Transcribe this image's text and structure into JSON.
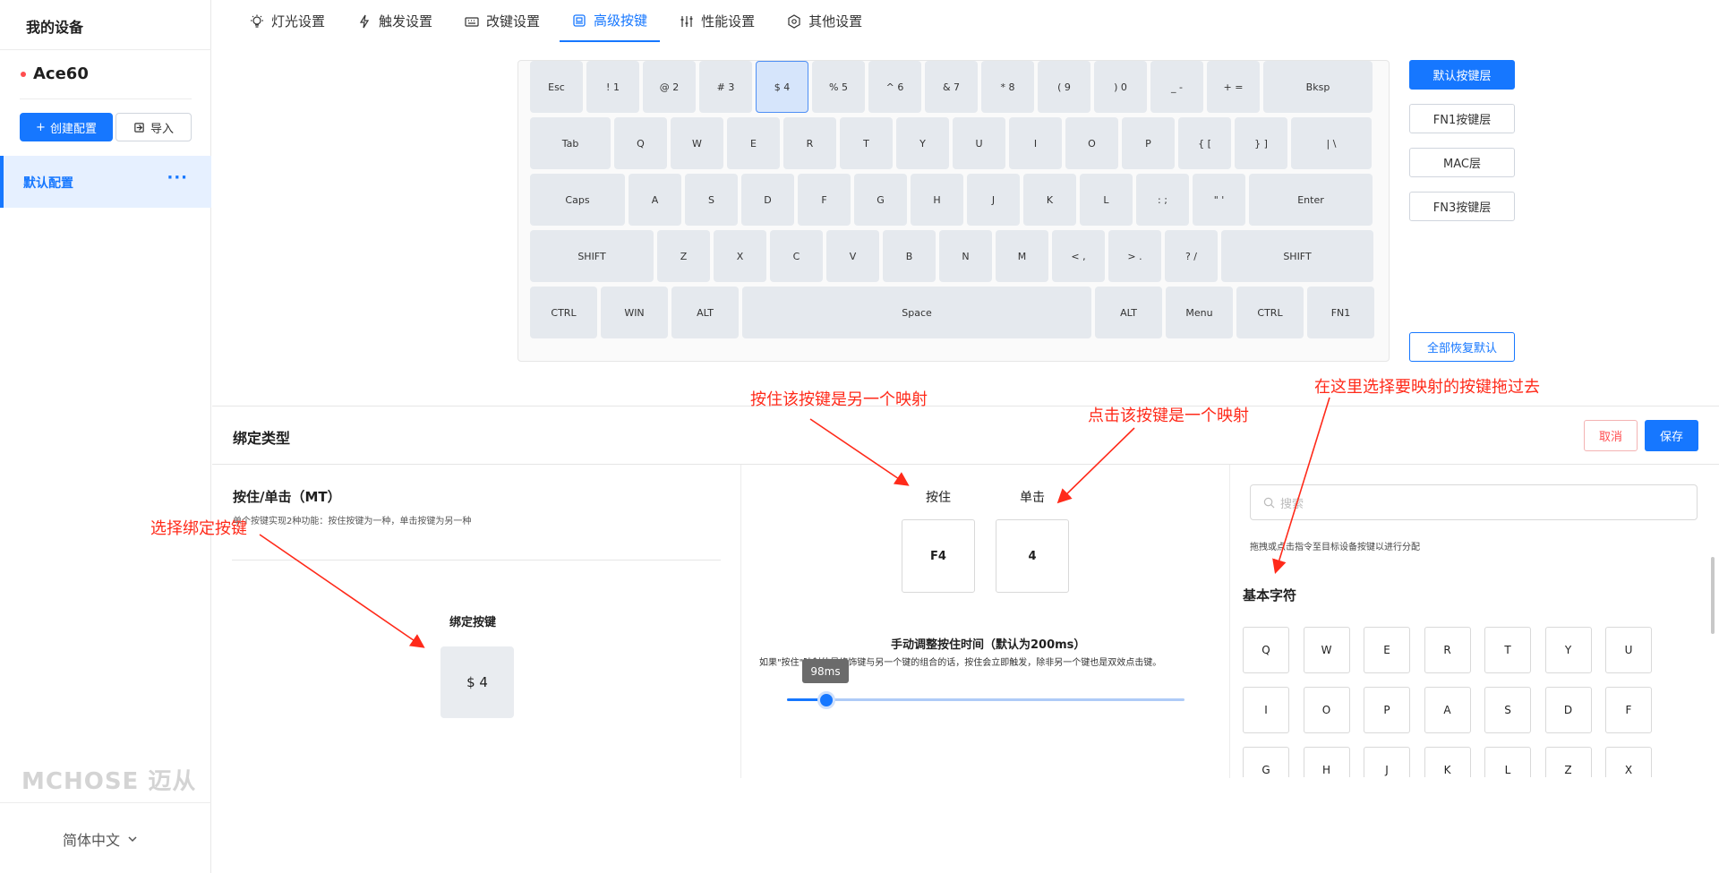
{
  "sidebar": {
    "title": "我的设备",
    "device_name": "Ace60",
    "create_label": "创建配置",
    "import_label": "导入",
    "config_name": "默认配置",
    "more_label": "···",
    "brand": "MCHOSE 迈从",
    "language": "简体中文"
  },
  "tabs": [
    {
      "label": "灯光设置",
      "icon": "bulb-icon"
    },
    {
      "label": "触发设置",
      "icon": "lightning-icon"
    },
    {
      "label": "改键设置",
      "icon": "keyboard-icon"
    },
    {
      "label": "高级按键",
      "icon": "advanced-key-icon",
      "active": true
    },
    {
      "label": "性能设置",
      "icon": "sliders-icon"
    },
    {
      "label": "其他设置",
      "icon": "gear-icon"
    }
  ],
  "keyboard": {
    "selected_key": "$ 4",
    "rows": [
      [
        "Esc",
        "! 1",
        "@ 2",
        "# 3",
        "$ 4",
        "% 5",
        "^ 6",
        "& 7",
        "* 8",
        "( 9",
        ") 0",
        "_ -",
        "+ =",
        "Bksp"
      ],
      [
        "Tab",
        "Q",
        "W",
        "E",
        "R",
        "T",
        "Y",
        "U",
        "I",
        "O",
        "P",
        "{ [",
        "} ]",
        "| \\"
      ],
      [
        "Caps",
        "A",
        "S",
        "D",
        "F",
        "G",
        "H",
        "J",
        "K",
        "L",
        ": ;",
        "\" '",
        "Enter"
      ],
      [
        "SHIFT",
        "Z",
        "X",
        "C",
        "V",
        "B",
        "N",
        "M",
        "< ,",
        "> .",
        "? /",
        "SHIFT"
      ],
      [
        "CTRL",
        "WIN",
        "ALT",
        "Space",
        "ALT",
        "Menu",
        "CTRL",
        "FN1"
      ]
    ]
  },
  "layers": {
    "items": [
      "默认按键层",
      "FN1按键层",
      "MAC层",
      "FN3按键层"
    ],
    "active": "默认按键层",
    "reset_label": "全部恢复默认"
  },
  "panel": {
    "title": "绑定类型",
    "cancel_label": "取消",
    "save_label": "保存",
    "mt_title": "按住/单击（MT）",
    "mt_desc": "单个按键实现2种功能：按住按键为一种，单击按键为另一种",
    "bind_key_label": "绑定按键",
    "bind_key_value": "$ 4",
    "hold_label": "按住",
    "tap_label": "单击",
    "hold_value": "F4",
    "tap_value": "4",
    "adjust_title": "手动调整按住时间（默认为200ms）",
    "adjust_desc": "如果\"按住\"映射的是修饰键与另一个键的组合的话，按住会立即触发，除非另一个键也是双效点击键。",
    "slider_value_label": "98ms",
    "slider_fraction": 0.098,
    "search_placeholder": "搜索",
    "drag_tip": "拖拽或点击指令至目标设备按键以进行分配",
    "basic_title": "基本字符",
    "basic_chars": [
      "Q",
      "W",
      "E",
      "R",
      "T",
      "Y",
      "U",
      "I",
      "O",
      "P",
      "A",
      "S",
      "D",
      "F",
      "G",
      "H",
      "J",
      "K",
      "L",
      "Z",
      "X"
    ]
  },
  "annotations": {
    "hold": "按住该按键是另一个映射",
    "tap": "点击该按键是一个映射",
    "drag": "在这里选择要映射的按键拖过去",
    "select": "选择绑定按键"
  },
  "colors": {
    "accent": "#1677ff",
    "annotation": "#ff2a1a",
    "key_bg": "#e5e9ee",
    "selected_key_bg": "#d6e5fb"
  }
}
